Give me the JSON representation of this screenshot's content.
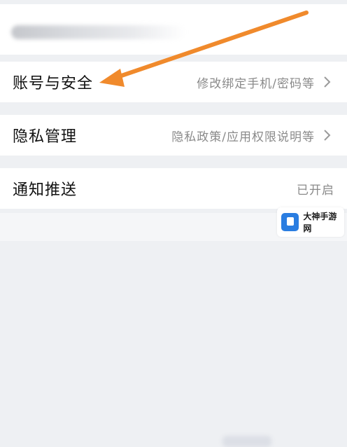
{
  "rows": [
    {
      "title": "账号与安全",
      "desc": "修改绑定手机/密码等"
    },
    {
      "title": "隐私管理",
      "desc": "隐私政策/应用权限说明等"
    },
    {
      "title": "通知推送",
      "desc": "已开启"
    }
  ],
  "colors": {
    "arrow": "#f08a2c",
    "background": "#eef0f3",
    "row": "#ffffff",
    "badge_icon": "#2a7de1"
  },
  "icons": {
    "row_chevron": "chevron-right-icon",
    "annotation": "arrow-icon"
  },
  "watermark": {
    "name": "大神手游网"
  }
}
